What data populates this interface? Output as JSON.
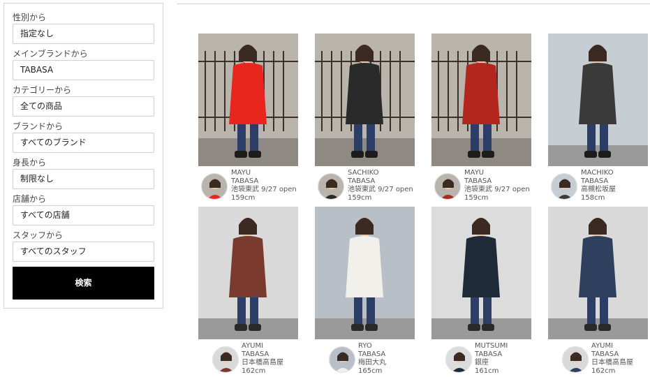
{
  "filters": [
    {
      "label": "性別から",
      "value": "指定なし"
    },
    {
      "label": "メインブランドから",
      "value": "TABASA"
    },
    {
      "label": "カテゴリーから",
      "value": "全ての商品"
    },
    {
      "label": "ブランドから",
      "value": "すべてのブランド"
    },
    {
      "label": "身長から",
      "value": "制限なし"
    },
    {
      "label": "店舗から",
      "value": "すべての店舗"
    },
    {
      "label": "スタッフから",
      "value": "すべてのスタッフ"
    }
  ],
  "search_label": "検索",
  "cards": [
    {
      "name": "MAYU",
      "brand": "TABASA",
      "store": "池袋東武 9/27 open",
      "height": "159cm",
      "outfit": "#e8261e",
      "bg": "#b9b4ac"
    },
    {
      "name": "SACHIKO",
      "brand": "TABASA",
      "store": "池袋東武 9/27 open",
      "height": "159cm",
      "outfit": "#2a2a2a",
      "bg": "#b9b4ac"
    },
    {
      "name": "MAYU",
      "brand": "TABASA",
      "store": "池袋東武 9/27 open",
      "height": "159cm",
      "outfit": "#b3261e",
      "bg": "#b9b4ac"
    },
    {
      "name": "MACHIKO",
      "brand": "TABASA",
      "store": "高槻松坂屋",
      "height": "158cm",
      "outfit": "#3a3a3a",
      "bg": "#c6cdd3"
    },
    {
      "name": "AYUMI",
      "brand": "TABASA",
      "store": "日本橋高島屋",
      "height": "162cm",
      "outfit": "#7a3b2e",
      "bg": "#d9d9d9"
    },
    {
      "name": "RYO",
      "brand": "TABASA",
      "store": "梅田大丸",
      "height": "165cm",
      "outfit": "#f2f0ea",
      "bg": "#b8bfc6"
    },
    {
      "name": "MUTSUMI",
      "brand": "TABASA",
      "store": "銀座",
      "height": "161cm",
      "outfit": "#1f2a38",
      "bg": "#dcdcdc"
    },
    {
      "name": "AYUMI",
      "brand": "TABASA",
      "store": "日本橋高島屋",
      "height": "162cm",
      "outfit": "#2f3f5e",
      "bg": "#d9d9d9"
    }
  ]
}
